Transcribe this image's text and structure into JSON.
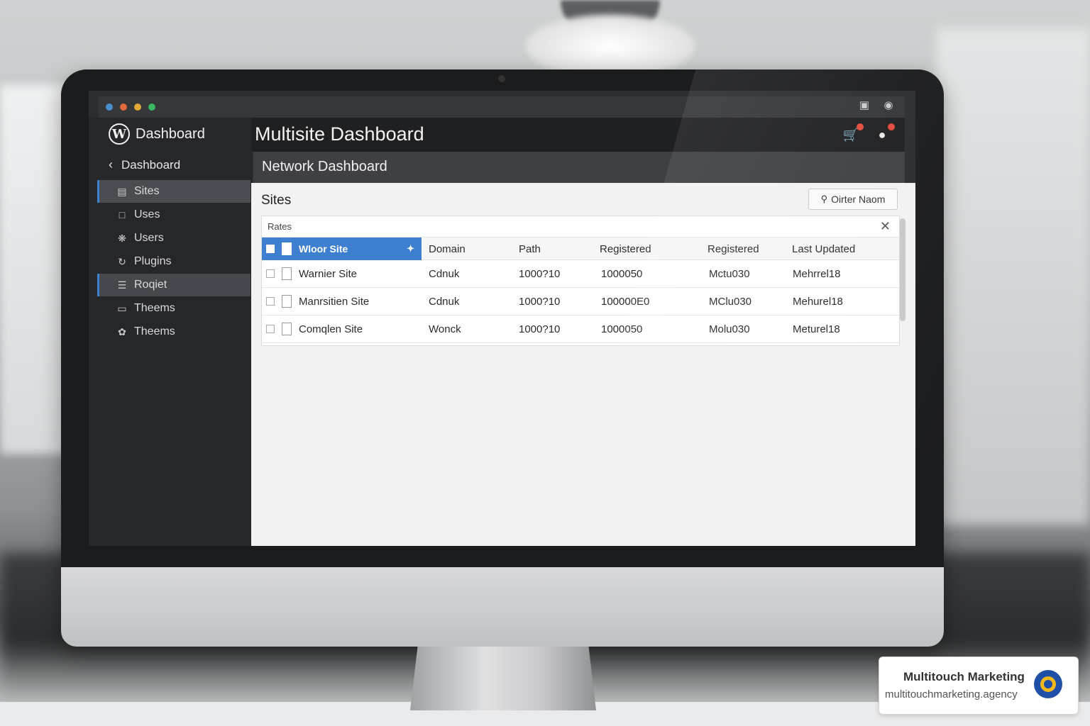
{
  "window": {
    "app_title": "Dashboard",
    "header_title": "Multisite Dashboard",
    "subheader_title": "Network Dashboard"
  },
  "sidebar": {
    "back_label": "Dashboard",
    "items": [
      {
        "label": "Sites",
        "icon": "sites-icon",
        "state": "active"
      },
      {
        "label": "Uses",
        "icon": "lock-icon",
        "state": ""
      },
      {
        "label": "Users",
        "icon": "gear-icon",
        "state": ""
      },
      {
        "label": "Plugins",
        "icon": "plugin-icon",
        "state": ""
      },
      {
        "label": "Roqiet",
        "icon": "list-icon",
        "state": "selected"
      },
      {
        "label": "Theems",
        "icon": "monitor-icon",
        "state": ""
      },
      {
        "label": "Theems",
        "icon": "palette-icon",
        "state": ""
      }
    ]
  },
  "header_icons": [
    "cart-icon",
    "notification-icon"
  ],
  "titlebar_icons": [
    "share-icon",
    "settings-icon"
  ],
  "content": {
    "section_title": "Sites",
    "filter_button": "Oirter Naom",
    "panel_label": "Rates",
    "columns": [
      "Wloor Site",
      "Domain",
      "Path",
      "Registered",
      "Registered",
      "Last Updated"
    ],
    "rows": [
      [
        "Warnier Site",
        "Cdnuk",
        "1000?10",
        "1000050",
        "Mctu030",
        "Mehrrel18"
      ],
      [
        "Manrsitien Site",
        "Cdnuk",
        "1000?10",
        "100000E0",
        "MClu030",
        "Mehurel18"
      ],
      [
        "Comqlen Site",
        "Wonck",
        "1000?10",
        "1000050",
        "Molu030",
        "Meturel18"
      ]
    ]
  },
  "watermark": {
    "name": "Multitouch Marketing",
    "url": "multitouchmarketing.agency"
  },
  "colors": {
    "accent": "#3f7fcf",
    "sidebar_bg": "#25272a",
    "header_bg": "#1f2022",
    "content_bg": "#f2f2f2",
    "badge": "#e24b3b"
  }
}
